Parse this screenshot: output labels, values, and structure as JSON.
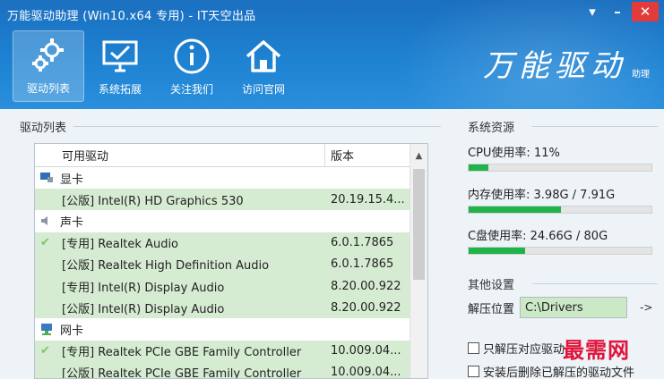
{
  "window": {
    "title": "万能驱动助理 (Win10.x64 专用) - IT天空出品",
    "controls": {
      "menu": "▾",
      "minimize": "–",
      "close": "✕"
    }
  },
  "toolbar": [
    {
      "label": "驱动列表",
      "icon": "gears-icon",
      "active": true
    },
    {
      "label": "系统拓展",
      "icon": "monitor-check-icon",
      "active": false
    },
    {
      "label": "关注我们",
      "icon": "info-icon",
      "active": false
    },
    {
      "label": "访问官网",
      "icon": "home-icon",
      "active": false
    }
  ],
  "brand": {
    "logo": "万能驱动",
    "sub": "助理"
  },
  "driver_list": {
    "title": "驱动列表",
    "columns": {
      "name": "可用驱动",
      "version": "版本"
    },
    "rows": [
      {
        "type": "cat",
        "name": "显卡",
        "icon": "display-adapter-icon"
      },
      {
        "type": "item",
        "name": "[公版] Intel(R) HD Graphics 530",
        "version": "20.19.15.4...",
        "checked": false
      },
      {
        "type": "cat",
        "name": "声卡",
        "icon": "speaker-icon"
      },
      {
        "type": "item",
        "name": "[专用] Realtek Audio",
        "version": "6.0.1.7865",
        "checked": true
      },
      {
        "type": "item",
        "name": "[公版] Realtek High Definition Audio",
        "version": "6.0.1.7865",
        "checked": false
      },
      {
        "type": "item",
        "name": "[专用] Intel(R) Display Audio",
        "version": "8.20.00.922",
        "checked": false
      },
      {
        "type": "item",
        "name": "[公版] Intel(R) Display Audio",
        "version": "8.20.00.922",
        "checked": false
      },
      {
        "type": "cat",
        "name": "网卡",
        "icon": "network-icon"
      },
      {
        "type": "item",
        "name": "[专用] Realtek PCIe GBE Family Controller",
        "version": "10.009.04...",
        "checked": true
      },
      {
        "type": "item",
        "name": "[公版] Realtek PCIe GBE Family Controller",
        "version": "10.009.04...",
        "checked": false
      }
    ]
  },
  "system_resources": {
    "title": "系统资源",
    "cpu": {
      "label": "CPU使用率: ",
      "value": "11%",
      "fraction": 0.11
    },
    "memory": {
      "label": "内存使用率: ",
      "value": "3.98G / 7.91G",
      "fraction": 0.503
    },
    "disk": {
      "label": "C盘使用率: ",
      "value": "24.66G / 80G",
      "fraction": 0.308
    }
  },
  "other_settings": {
    "title": "其他设置",
    "unzip_label": "解压位置",
    "unzip_path": "C:\\Drivers",
    "browse": "->",
    "options": [
      {
        "label": "只解压对应驱动",
        "checked": false
      },
      {
        "label": "安装后删除已解压的驱动文件",
        "checked": false
      }
    ]
  },
  "watermark": "最需网",
  "colors": {
    "header": "#1e82d2",
    "row_highlight": "#d6ecd2",
    "bar": "#1fb34a",
    "accent_red": "#e0143c"
  }
}
